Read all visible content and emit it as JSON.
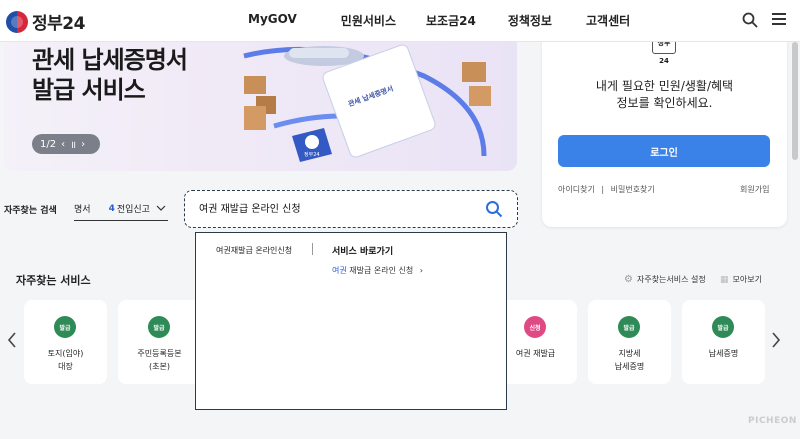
{
  "header": {
    "logo_text": "정부24",
    "nav": [
      "MyGOV",
      "민원서비스",
      "보조금24",
      "정책정보",
      "고객센터"
    ]
  },
  "banner": {
    "title_line1": "관세 납세증명서",
    "title_line2": "발급 서비스",
    "pager": "1/2",
    "doc_label": "관세 납세증명서",
    "seal_label": "정부24"
  },
  "login": {
    "icon_text": "정부24",
    "message_line1": "내게 필요한 민원/생활/혜택",
    "message_line2": "정보를 확인하세요.",
    "button_label": "로그인",
    "find_id": "아이디찾기",
    "find_pw": "비밀번호찾기",
    "signup": "회원가입"
  },
  "frequent_search": {
    "label": "자주찾는 검색",
    "prev_text": "명서",
    "number": "4",
    "item": "전입신고"
  },
  "search": {
    "value": "여권 재발급 온라인 신청"
  },
  "autocomplete": {
    "suggestion": "여권재발급 온라인신청",
    "section_title": "서비스 바로가기",
    "link_highlight": "여권",
    "link_rest": " 재발급 온라인 신청",
    "link_arrow": "›"
  },
  "services": {
    "title": "자주찾는 서비스",
    "settings": "자주찾는서비스 설정",
    "view_all": "모아보기",
    "cards": [
      {
        "badge": "발급",
        "line1": "토지(임야)",
        "line2": "대장",
        "color": "#2e8b57"
      },
      {
        "badge": "발급",
        "line1": "주민등록등본",
        "line2": "(초본)",
        "color": "#2e8b57"
      },
      {
        "badge": "신청",
        "line1": "여권 재발급",
        "line2": "",
        "color": "#e04a84"
      },
      {
        "badge": "발급",
        "line1": "지방세",
        "line2": "납세증명",
        "color": "#2e8b57"
      },
      {
        "badge": "발급",
        "line1": "납세증명",
        "line2": "",
        "color": "#2e8b57"
      }
    ]
  },
  "watermark": "PICHEON"
}
